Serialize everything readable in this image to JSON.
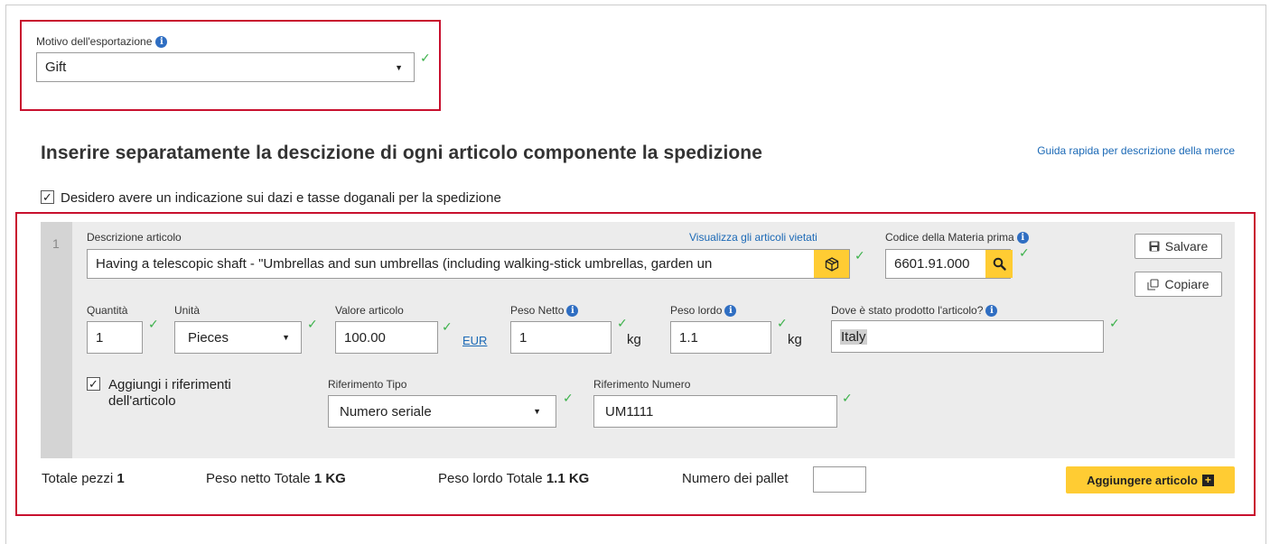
{
  "motivo": {
    "label": "Motivo dell'esportazione",
    "selected": "Gift"
  },
  "section": {
    "heading": "Inserire separatamente la descizione di ogni articolo componente la spedizione",
    "guide_link": "Guida rapida per descrizione della merce",
    "duties_checkbox_label": "Desidero avere un indicazione sui dazi e tasse doganali per la spedizione",
    "duties_checked": true
  },
  "item": {
    "number": "1",
    "description_label": "Descrizione articolo",
    "prohibited_link": "Visualizza gli articoli vietati",
    "description_value": "Having a telescopic shaft - \"Umbrellas and sun umbrellas (including walking-stick umbrellas, garden un",
    "commodity_label": "Codice della Materia prima",
    "commodity_value": "6601.91.000",
    "save_label": "Salvare",
    "copy_label": "Copiare",
    "quantity_label": "Quantità",
    "quantity_value": "1",
    "unit_label": "Unità",
    "unit_value": "Pieces",
    "value_label": "Valore articolo",
    "value_value": "100.00",
    "currency": "EUR",
    "net_weight_label": "Peso Netto",
    "net_weight_value": "1",
    "gross_weight_label": "Peso lordo",
    "gross_weight_value": "1.1",
    "weight_unit": "kg",
    "origin_label": "Dove è stato prodotto l'articolo?",
    "origin_value": "Italy",
    "refs_checkbox_line1": "Aggiungi i riferimenti",
    "refs_checkbox_line2": "dell'articolo",
    "refs_checked": true,
    "ref_type_label": "Riferimento Tipo",
    "ref_type_value": "Numero seriale",
    "ref_number_label": "Riferimento Numero",
    "ref_number_value": "UM1111"
  },
  "totals": {
    "pieces_label": "Totale pezzi",
    "pieces_value": "1",
    "net_label": "Peso netto Totale",
    "net_value": "1 KG",
    "gross_label": "Peso lordo Totale",
    "gross_value": "1.1 KG",
    "pallet_label": "Numero dei pallet",
    "pallet_value": "",
    "add_item_label": "Aggiungere articolo"
  },
  "colors": {
    "highlight": "#c8102e",
    "accent_yellow": "#ffcc33",
    "link_blue": "#1b69b6",
    "valid_green": "#3bb14a",
    "info_blue": "#2f6ec2"
  }
}
